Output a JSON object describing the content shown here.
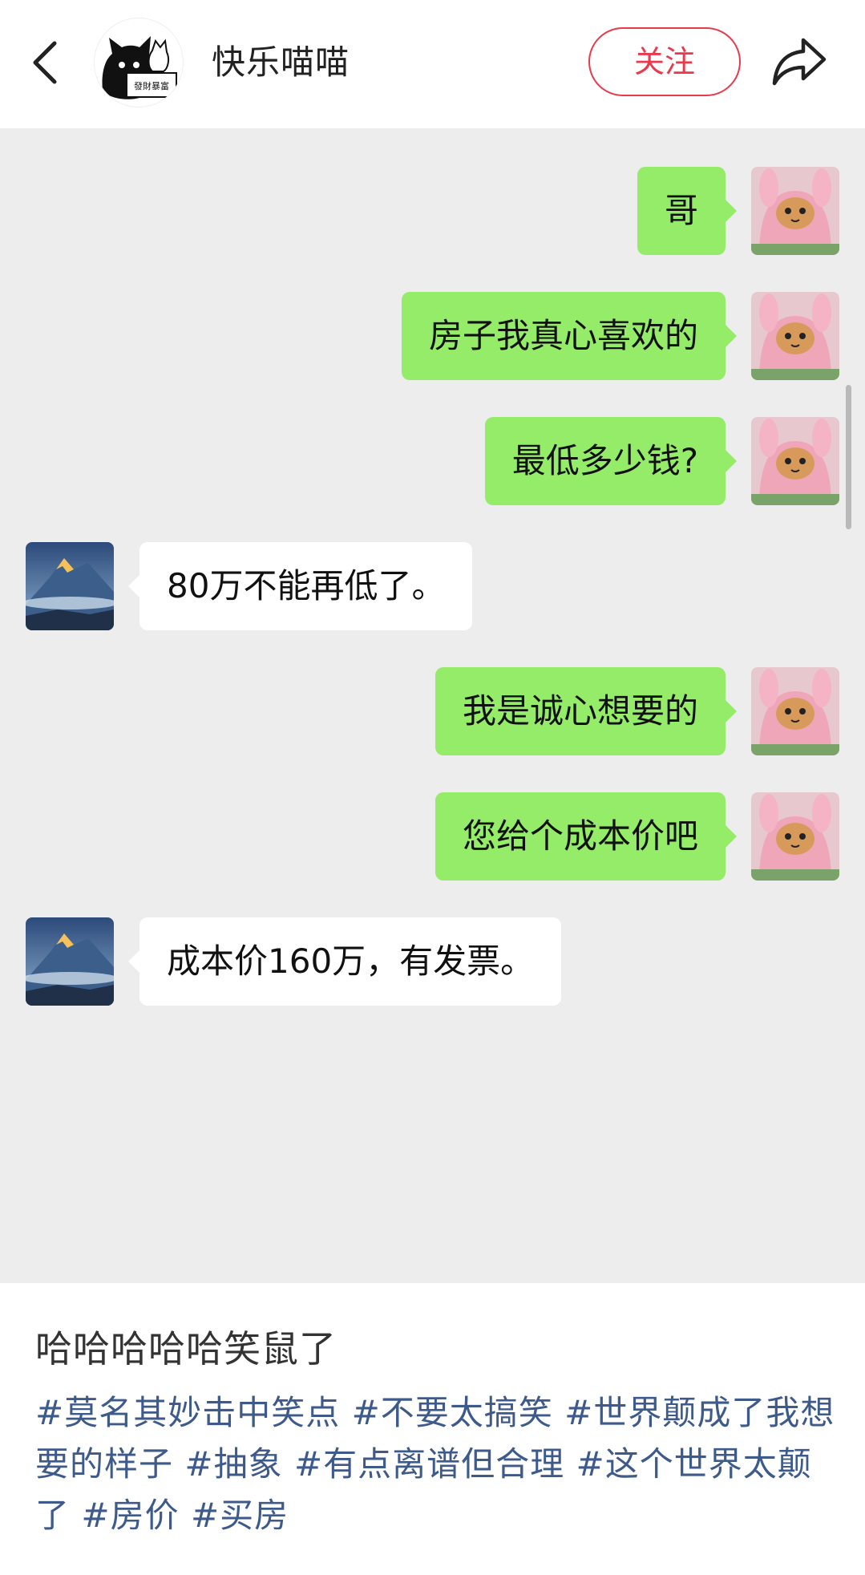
{
  "header": {
    "author_name": "快乐喵喵",
    "follow_label": "关注",
    "avatar_text": "發財暴富"
  },
  "chat": {
    "messages": [
      {
        "side": "me",
        "text": "哥"
      },
      {
        "side": "me",
        "text": "房子我真心喜欢的"
      },
      {
        "side": "me",
        "text": "最低多少钱?"
      },
      {
        "side": "them",
        "text": "80万不能再低了。"
      },
      {
        "side": "me",
        "text": "我是诚心想要的"
      },
      {
        "side": "me",
        "text": "您给个成本价吧"
      },
      {
        "side": "them",
        "text": "成本价160万，有发票。"
      }
    ],
    "bubble_colors": {
      "me": "#95ec69",
      "them": "#ffffff"
    }
  },
  "caption": {
    "title": "哈哈哈哈哈笑鼠了",
    "hashtags": [
      "#莫名其妙击中笑点",
      "#不要太搞笑",
      "#世界颠成了我想要的样子",
      "#抽象",
      "#有点离谱但合理",
      "#这个世界太颠了",
      "#房价",
      "#买房"
    ]
  },
  "colors": {
    "accent_red": "#e8394d",
    "hashtag_blue": "#3d5a8a",
    "chat_background": "#ededed"
  }
}
